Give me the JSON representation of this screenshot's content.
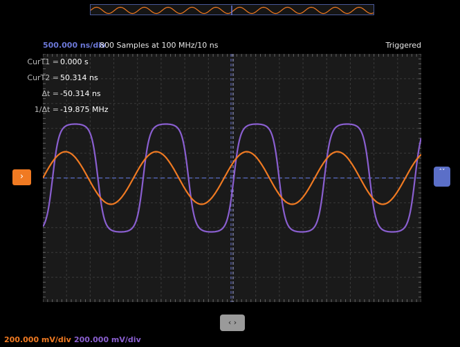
{
  "header": {
    "timebase": "500.000 ns/div",
    "samples": "800 Samples at 100 MHz/10 ns",
    "status": "Triggered"
  },
  "readouts": [
    {
      "label": "CurT1 =",
      "value": "0.000 s"
    },
    {
      "label": "CurT2 =",
      "value": "50.314 ns"
    },
    {
      "label": "Δt =",
      "value": "-50.314 ns"
    },
    {
      "label": "1/Δt =",
      "value": "-19.875 MHz"
    }
  ],
  "channels": [
    {
      "scale": "200.000 mV/div",
      "color": "#f07a22",
      "marker_icon": "chevron-right-icon"
    },
    {
      "scale": "200.000 mV/div",
      "color": "#8a5fd0",
      "marker_icon": "chevron-up-down-icon"
    }
  ],
  "controls": {
    "pan_icon": "chevron-left-right-icon",
    "pan_label": "‹ ›",
    "ch1_marker_label": "›",
    "ch2_marker_label": "˄˅"
  },
  "colors": {
    "grid_bg": "#1a1a1a",
    "cursor": "#6c78d8",
    "trigger_level": "#5b6fc8"
  }
}
